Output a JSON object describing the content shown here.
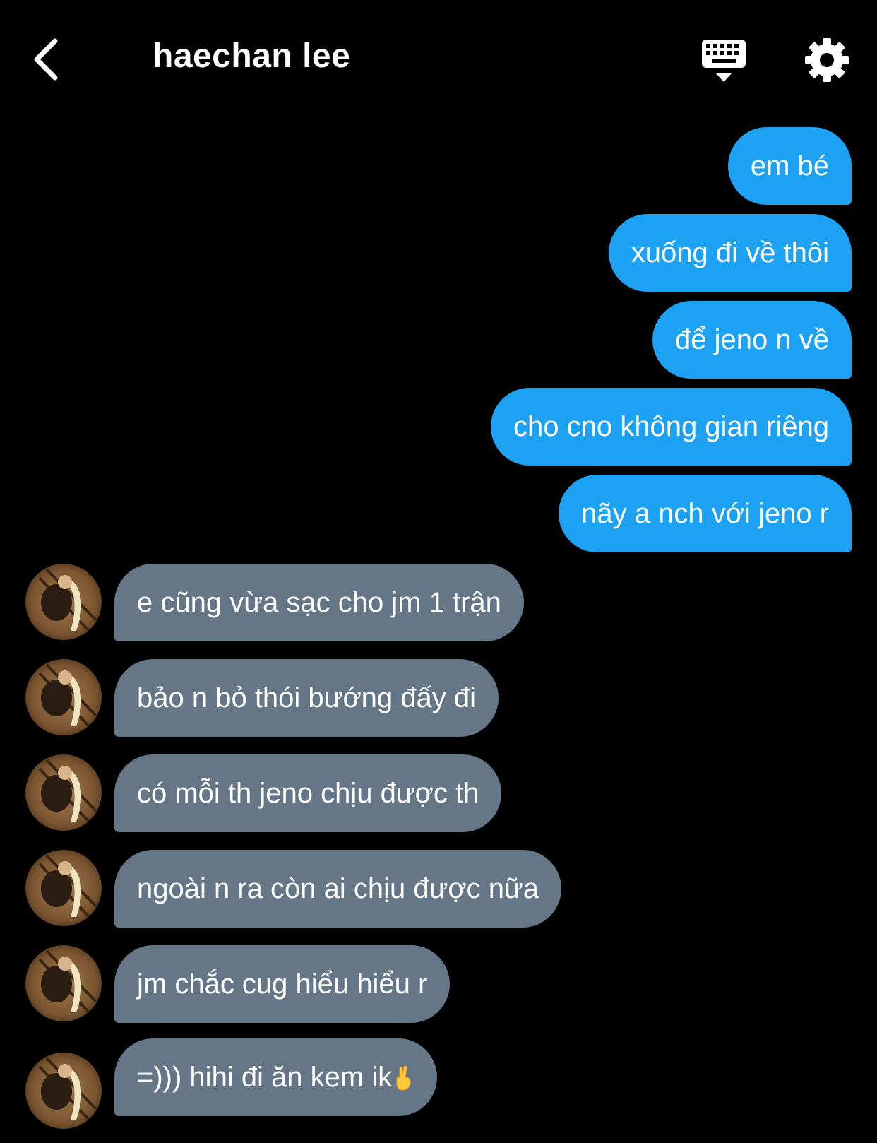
{
  "header": {
    "title": "haechan lee",
    "back_icon": "chevron-left-icon",
    "keyboard_icon": "keyboard-dismiss-icon",
    "settings_icon": "gear-icon"
  },
  "colors": {
    "background": "#000000",
    "outgoing_bubble": "#1da1f2",
    "incoming_bubble": "#657786",
    "text": "#ffffff"
  },
  "messages": {
    "outgoing": [
      {
        "text": "em bé"
      },
      {
        "text": "xuống đi về thôi"
      },
      {
        "text": "để jeno n về"
      },
      {
        "text": "cho cno không gian riêng"
      },
      {
        "text": "nãy a nch với jeno r"
      }
    ],
    "incoming": [
      {
        "text": "e cũng vừa sạc cho jm 1 trận"
      },
      {
        "text": "bảo n bỏ thói bướng đấy đi"
      },
      {
        "text": "có mỗi th jeno chịu được th"
      },
      {
        "text": "ngoài n ra còn ai chịu được nữa"
      },
      {
        "text": "jm chắc cug hiểu hiểu r"
      },
      {
        "text": "=))) hihi đi ăn kem ik",
        "emoji": "crossed-fingers-emoji"
      }
    ]
  }
}
